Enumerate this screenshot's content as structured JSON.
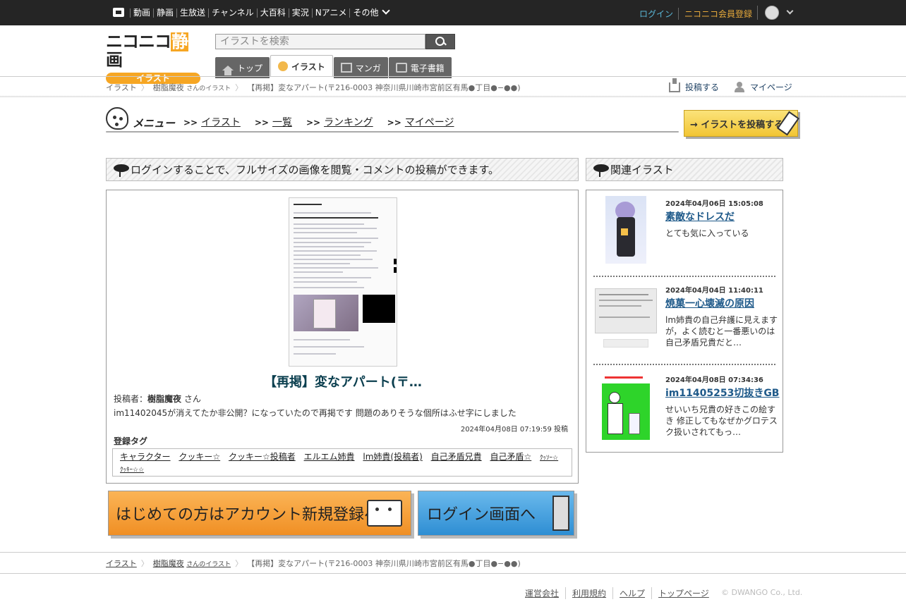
{
  "topbar": {
    "nav": [
      "動画",
      "静画",
      "生放送",
      "チャンネル",
      "大百科",
      "実況",
      "Nアニメ",
      "その他"
    ],
    "login": "ログイン",
    "register": "ニコニコ会員登録"
  },
  "header": {
    "logo_main_left": "ニコニコ",
    "logo_main_hl": "静",
    "logo_main_right": "画",
    "logo_sub": "イラスト",
    "search_placeholder": "イラストを検索",
    "tabs": [
      "トップ",
      "イラスト",
      "マンガ",
      "電子書籍"
    ]
  },
  "breadcrumb": {
    "root": "イラスト",
    "user": "樹脂魔夜",
    "user_suffix": "さんのイラスト",
    "current": "【再掲】変なアパート(〒216-0003 神奈川県川崎市宮前区有馬●丁目●−●●)"
  },
  "actions": {
    "post": "投稿する",
    "mypage": "マイページ"
  },
  "menu": {
    "title": "メニュー",
    "arrow": ">>",
    "links": [
      "イラスト",
      "一覧",
      "ランキング",
      "マイページ"
    ],
    "post_button": "→ イラストを投稿する"
  },
  "main": {
    "notice": "ログインすることで、フルサイズの画像を閲覧・コメントの投稿ができます。",
    "title": "【再掲】変なアパート(〒…",
    "poster_label": "投稿者：",
    "poster_name": "樹脂魔夜",
    "poster_suffix": "さん",
    "description": "im11402045が消えてたか非公開？になっていたので再掲です 問題のありそうな個所はふせ字にしました",
    "posted_at": "2024年04月08日 07:19:59 投稿",
    "tags_heading": "登録タグ",
    "tags": [
      "キャラクター",
      "クッキー☆",
      "クッキー☆投稿者",
      "エルエム姉貴",
      "lm姉貴(投稿者)",
      "自己矛盾兄貴",
      "自己矛盾☆"
    ],
    "tags_small": [
      "ｸｯｿｰ☆",
      "ｸｯｷｰ☆☆"
    ]
  },
  "banners": {
    "signup": "はじめての方はアカウント新規登録へ",
    "login": "ログイン画面へ"
  },
  "related": {
    "heading": "関連イラスト",
    "items": [
      {
        "date": "2024年04月06日 15:05:08",
        "title": "素敵なドレスだ",
        "desc": "とても気に入っている"
      },
      {
        "date": "2024年04月04日 11:40:11",
        "title": "焼菓一心壊滅の原因",
        "desc": "lm姉貴の自己弁護に見えますが，よく読むと一番悪いのは自己矛盾兄貴だと…"
      },
      {
        "date": "2024年04月08日 07:34:36",
        "title": "im11405253切抜きGB",
        "desc": "せいいち兄貴の好きこの絵すき 修正してもなぜかグロテスク扱いされてもっ…"
      }
    ]
  },
  "footer": {
    "links": [
      "運営会社",
      "利用規約",
      "ヘルプ",
      "トップページ"
    ],
    "copyright": "© DWANGO Co., Ltd."
  }
}
